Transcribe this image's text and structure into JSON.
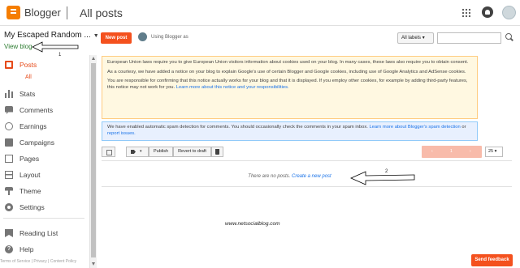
{
  "header": {
    "brand": "Blogger",
    "page_title": "All posts"
  },
  "sidebar": {
    "blog_name": "My Escaped Random ...",
    "view_blog": "View blog",
    "annotation": "1",
    "items": [
      {
        "label": "Posts",
        "icon": "posts-icon",
        "active": true
      },
      {
        "label": "All",
        "sub": true
      },
      {
        "label": "Stats",
        "icon": "stats-icon"
      },
      {
        "label": "Comments",
        "icon": "comments-icon"
      },
      {
        "label": "Earnings",
        "icon": "earnings-icon"
      },
      {
        "label": "Campaigns",
        "icon": "campaigns-icon"
      },
      {
        "label": "Pages",
        "icon": "pages-icon"
      },
      {
        "label": "Layout",
        "icon": "layout-icon"
      },
      {
        "label": "Theme",
        "icon": "theme-icon"
      },
      {
        "label": "Settings",
        "icon": "settings-icon"
      }
    ],
    "bottom_items": [
      {
        "label": "Reading List",
        "icon": "reading-list-icon"
      },
      {
        "label": "Help",
        "icon": "help-icon"
      }
    ],
    "footer": {
      "terms": "Terms of Service",
      "sep1": "|",
      "privacy": "Privacy",
      "sep2": "|",
      "policy": "Content Policy"
    }
  },
  "toolbar_top": {
    "new_post": "New post",
    "using_as": "Using Blogger as",
    "labels_filter": "All labels",
    "labels_caret": "▾",
    "search_placeholder": ""
  },
  "notices": {
    "eu_p1": "European Union laws require you to give European Union visitors information about cookies used on your blog. In many cases, these laws also require you to obtain consent.",
    "eu_p2": "As a courtesy, we have added a notice on your blog to explain Google's use of certain Blogger and Google cookies, including use of Google Analytics and AdSense cookies.",
    "eu_p3_text": "You are responsible for confirming that this notice actually works for your blog and that it is displayed. If you employ other cookies, for example by adding third-party features, this notice may not work for you.",
    "eu_p3_link": "Learn more about this notice and your responsibilities.",
    "spam_text": "We have enabled automatic spam detection for comments. You should occasionally check the comments in your spam inbox.",
    "spam_link1": "Learn more about Blogger's spam detection",
    "spam_or": "or",
    "spam_link2": "report issues."
  },
  "list_toolbar": {
    "label_caret": "▾",
    "publish": "Publish",
    "revert": "Revert to draft",
    "pager_first": "‹",
    "pager_page": "1",
    "pager_next": "›",
    "page_size": "25",
    "page_size_caret": "▾"
  },
  "posts": {
    "empty_text": "There are no posts.",
    "create_link": "Create a new post",
    "annotation": "2"
  },
  "watermark": "www.netsocialblog.com",
  "feedback": "Send feedback",
  "colors": {
    "accent": "#f4511e",
    "active_text": "#e64a19",
    "notice_bg": "#fff8e1",
    "info_bg": "#e8f0fe",
    "link": "#1a73e8"
  }
}
